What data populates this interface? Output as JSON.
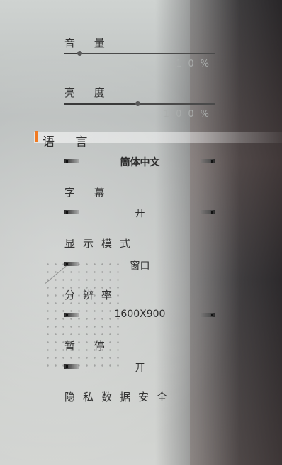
{
  "settings": {
    "volume": {
      "label": "音 量",
      "value_text": "10%",
      "level": 0.1
    },
    "brightness": {
      "label": "亮 度",
      "value_text": "100%",
      "level": 0.485
    },
    "language": {
      "label": "语 言",
      "value": "簡体中文"
    },
    "subtitles": {
      "label": "字 幕",
      "value": "开"
    },
    "display_mode": {
      "label": "显示模式",
      "value": "窗口"
    },
    "resolution": {
      "label": "分辨率",
      "value": "1600X900"
    },
    "pause": {
      "label": "暂 停",
      "value": "开"
    },
    "privacy": {
      "label": "隐私数据安全"
    }
  },
  "colors": {
    "accent": "#f07a22",
    "text": "#333333",
    "percent_text": "#a9acab"
  }
}
